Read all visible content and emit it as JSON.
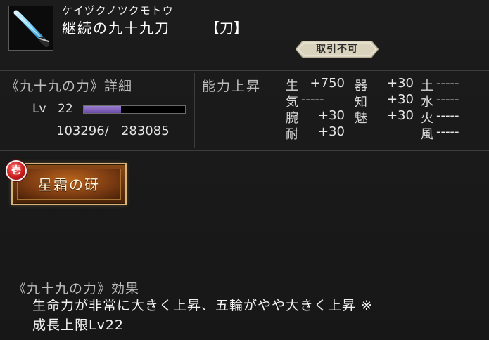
{
  "item": {
    "icon": "sword-icon",
    "reading": "ケイヅクノツクモトウ",
    "name": "継続の九十九刀",
    "type": "【刀】",
    "trade_badge": "取引不可"
  },
  "power": {
    "title": "《九十九の力》詳細",
    "level_label": "Lv",
    "level_value": "22",
    "exp_text": "103296/   283085",
    "exp_fraction": 0.365
  },
  "stats": {
    "title": "能力上昇",
    "items": [
      {
        "label": "生",
        "value": "+750"
      },
      {
        "label": "器",
        "value": "+30"
      },
      {
        "label": "土",
        "value": "-----"
      },
      {
        "label": "気",
        "value": "-----"
      },
      {
        "label": "知",
        "value": "+30"
      },
      {
        "label": "水",
        "value": "-----"
      },
      {
        "label": "腕",
        "value": "+30"
      },
      {
        "label": "魅",
        "value": "+30"
      },
      {
        "label": "火",
        "value": "-----"
      },
      {
        "label": "耐",
        "value": "+30"
      },
      {
        "label": "",
        "value": ""
      },
      {
        "label": "風",
        "value": "-----"
      }
    ]
  },
  "skill": {
    "number_badge": "壱",
    "name": "星霜の砑"
  },
  "effect": {
    "title": "《九十九の力》効果",
    "line1": "生命力が非常に大きく上昇、五輪がやや大きく上昇 ※",
    "line2": "成長上限Lv22"
  },
  "colors": {
    "exp_bar": "#7b5bb8",
    "skill_frame": "#d6b47a",
    "skill_fill": "#7b3b12",
    "badge_red": "#c91f1f",
    "trade_badge": "#d9d3bd"
  }
}
